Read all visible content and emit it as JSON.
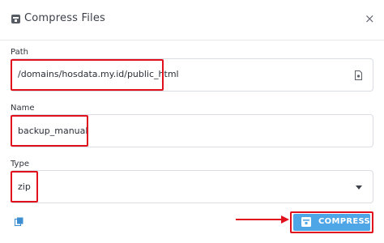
{
  "dialog": {
    "title": "Compress Files",
    "close_symbol": "×",
    "title_icon": "archive-icon"
  },
  "form": {
    "path": {
      "label": "Path",
      "value": "/domains/hosdata.my.id/public_html",
      "icon": "file-icon"
    },
    "name": {
      "label": "Name",
      "value": "backup_manual"
    },
    "type": {
      "label": "Type",
      "selected": "zip",
      "icon": "chevron-down-icon"
    }
  },
  "footer": {
    "left_icon": "copy-icon",
    "compress_label": "COMPRESS",
    "compress_icon": "archive-icon"
  },
  "colors": {
    "accent": "#4ea6e6",
    "highlight": "#e0101c",
    "border": "#d9dce2"
  }
}
